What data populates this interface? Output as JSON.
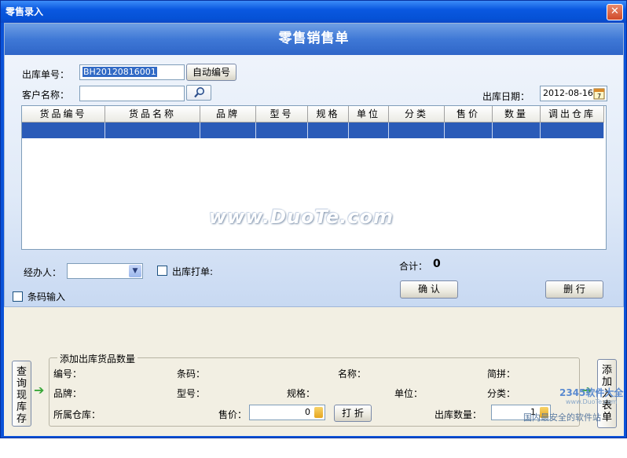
{
  "window": {
    "title": "零售录入",
    "close_glyph": "✕"
  },
  "banner": {
    "title": "零售销售单"
  },
  "form": {
    "order_no_label": "出库单号：",
    "order_no_value": "BH20120816001",
    "auto_no_button": "自动编号",
    "customer_label": "客户名称：",
    "customer_value": "",
    "date_label": "出库日期：",
    "date_value": "2012-08-16"
  },
  "grid": {
    "columns": [
      "货品编号",
      "货品名称",
      "品牌",
      "型号",
      "规格",
      "单位",
      "分类",
      "售价",
      "数量",
      "调出仓库"
    ]
  },
  "watermark": "www.DuoTe.com",
  "bottom_controls": {
    "handler_label": "经办人：",
    "print_label": "出库打单:",
    "barcode_label": "条码输入",
    "total_label": "合计：",
    "total_value": "0",
    "confirm_button": "确 认",
    "delete_button": "删 行"
  },
  "groupbox": {
    "title": "添加出库货品数量",
    "code_label": "编号：",
    "barcode_label": "条码：",
    "name_label": "名称：",
    "pinyin_label": "简拼：",
    "brand_label": "品牌：",
    "model_label": "型号：",
    "spec_label": "规格：",
    "unit_label": "单位：",
    "category_label": "分类：",
    "warehouse_label": "所属仓库：",
    "price_label": "售价：",
    "price_value": "0",
    "discount_button": "打 折",
    "qty_label": "出库数量：",
    "qty_value": "1"
  },
  "side_buttons": {
    "query_stock": "查询现库存",
    "add_to_list": "添加入表单"
  },
  "logo": {
    "site_text": "2345软件大全",
    "slogan": "国内最安全的软件站",
    "url_hint": "www.DuoTe.com"
  },
  "icons": {
    "search": "magnifier-icon",
    "calendar": "calendar-icon",
    "spinner": "spinner-icon",
    "arrow": "green-arrow-icon"
  }
}
